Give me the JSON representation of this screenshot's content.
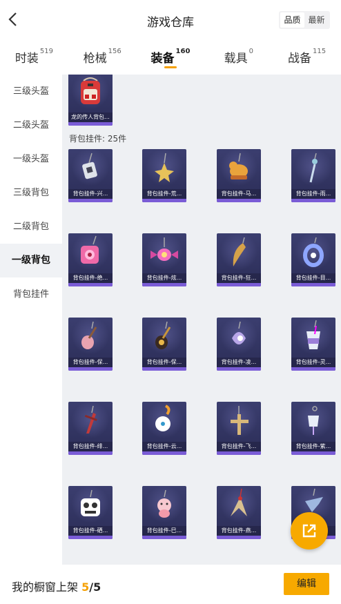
{
  "header": {
    "back_icon": "chevron-left-icon",
    "title": "游戏仓库",
    "sort_options": [
      "品质",
      "最新"
    ],
    "sort_selected": "品质"
  },
  "tabs": [
    {
      "label": "时装",
      "count": "519",
      "active": false
    },
    {
      "label": "枪械",
      "count": "156",
      "active": false
    },
    {
      "label": "装备",
      "count": "160",
      "active": true
    },
    {
      "label": "载具",
      "count": "0",
      "active": false
    },
    {
      "label": "战备",
      "count": "115",
      "active": false
    }
  ],
  "sidebar": {
    "items": [
      {
        "label": "三级头盔",
        "active": false
      },
      {
        "label": "二级头盔",
        "active": false
      },
      {
        "label": "一级头盔",
        "active": false
      },
      {
        "label": "三级背包",
        "active": false
      },
      {
        "label": "二级背包",
        "active": false
      },
      {
        "label": "一级背包",
        "active": true
      },
      {
        "label": "背包挂件",
        "active": false
      }
    ]
  },
  "main": {
    "top_item": {
      "caption": "龙的传人背包...",
      "icon": "backpack-icon"
    },
    "section_label": "背包挂件: 25件",
    "items": [
      {
        "caption": "背包挂件-兴...",
        "icon": "charm-tag-icon"
      },
      {
        "caption": "背包挂件-荒...",
        "icon": "charm-star-icon"
      },
      {
        "caption": "背包挂件-马...",
        "icon": "charm-horse-icon"
      },
      {
        "caption": "背包挂件-雨...",
        "icon": "charm-sword-icon"
      },
      {
        "caption": "背包挂件-绝...",
        "icon": "charm-pink-box-icon"
      },
      {
        "caption": "背包挂件-炫...",
        "icon": "charm-candy-icon"
      },
      {
        "caption": "背包挂件-狂...",
        "icon": "charm-horn-icon"
      },
      {
        "caption": "背包挂件-目...",
        "icon": "charm-ring-icon"
      },
      {
        "caption": "背包挂件-保...",
        "icon": "charm-guitar-icon"
      },
      {
        "caption": "背包挂件-保...",
        "icon": "charm-gold-guitar-icon"
      },
      {
        "caption": "背包挂件-凌...",
        "icon": "charm-gem-icon"
      },
      {
        "caption": "背包挂件-灵...",
        "icon": "charm-drink-icon"
      },
      {
        "caption": "背包挂件-绯...",
        "icon": "charm-dagger-icon"
      },
      {
        "caption": "背包挂件-云...",
        "icon": "charm-clock-icon"
      },
      {
        "caption": "背包挂件-飞...",
        "icon": "charm-cross-icon"
      },
      {
        "caption": "背包挂件-紫...",
        "icon": "charm-bell-icon"
      },
      {
        "caption": "背包挂件-硒...",
        "icon": "charm-panda-icon"
      },
      {
        "caption": "背包挂件-巳...",
        "icon": "charm-pig-icon"
      },
      {
        "caption": "背包挂件-燕...",
        "icon": "charm-swallow-icon"
      },
      {
        "caption": "背包挂件-...",
        "icon": "charm-plane-icon"
      }
    ]
  },
  "fab": {
    "icon": "share-external-icon"
  },
  "bottom": {
    "label": "我的橱窗上架",
    "current": "5",
    "separator": "/",
    "max": "5",
    "edit_label": "编辑"
  },
  "colors": {
    "accent": "#f7a900",
    "card_bg": "#2f3160",
    "card_bar": "#7a5cd6",
    "panel_bg": "#eef0f3"
  }
}
